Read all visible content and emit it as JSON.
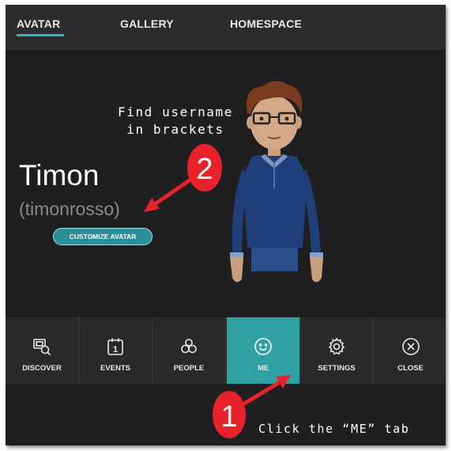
{
  "tabs": [
    {
      "label": "AVATAR",
      "active": true
    },
    {
      "label": "GALLERY",
      "active": false
    },
    {
      "label": "HOMESPACE",
      "active": false
    }
  ],
  "profile": {
    "display_name": "Timon",
    "username": "(timonrosso)",
    "customize_label": "CUSTOMIZE AVATAR"
  },
  "annotations": {
    "find_line1": "Find username",
    "find_line2": "in brackets",
    "click_me": "Click the “ME” tab",
    "step1": "1",
    "step2": "2"
  },
  "menu": {
    "items": [
      {
        "label": "DISCOVER",
        "icon": "discover-icon"
      },
      {
        "label": "EVENTS",
        "icon": "calendar-icon",
        "icon_text": "1"
      },
      {
        "label": "PEOPLE",
        "icon": "people-icon"
      },
      {
        "label": "ME",
        "icon": "smiley-icon",
        "active": true
      },
      {
        "label": "SETTINGS",
        "icon": "gear-icon"
      },
      {
        "label": "CLOSE",
        "icon": "close-circle-icon"
      }
    ]
  },
  "colors": {
    "accent": "#2fa1a4",
    "annotation_red": "#e8212b",
    "background": "#1f1f21"
  }
}
